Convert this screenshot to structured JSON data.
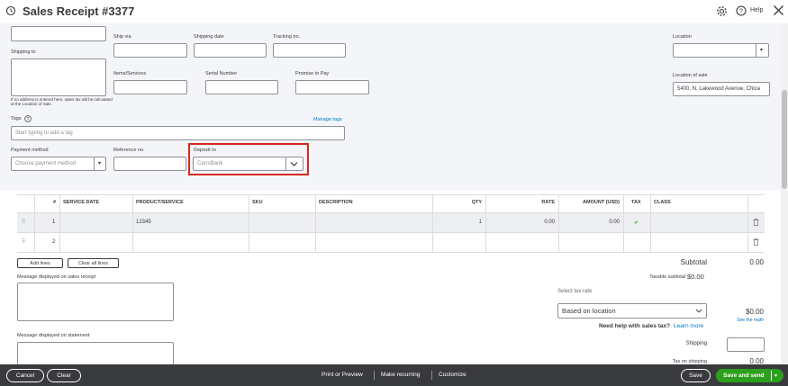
{
  "header": {
    "title": "Sales Receipt #3377",
    "help": "Help"
  },
  "form": {
    "shipping_to_label": "Shipping to",
    "address_note": "If no address is entered here, sales tax will be calculated at the Location of Sale.",
    "ship_via_label": "Ship via",
    "shipping_date_label": "Shipping date",
    "tracking_no_label": "Tracking no.",
    "items_services_label": "Items/Services",
    "serial_number_label": "Serial Number",
    "promise_to_pay_label": "Promise to Pay",
    "location_label": "Location",
    "location_of_sale_label": "Location of sale",
    "location_of_sale_value": "5400, N. Lakewood Avenue, Chica",
    "tags_label": "Tags",
    "manage_tags": "Manage tags",
    "tags_placeholder": "Start typing to add a tag",
    "payment_method_label": "Payment method",
    "payment_method_placeholder": "Choose payment method",
    "reference_no_label": "Reference no.",
    "deposit_to_label": "Deposit to",
    "deposit_to_value": "CarrsBank"
  },
  "table": {
    "headers": {
      "num": "#",
      "service_date": "SERVICE DATE",
      "product": "PRODUCT/SERVICE",
      "sku": "SKU",
      "description": "DESCRIPTION",
      "qty": "QTY",
      "rate": "RATE",
      "amount": "AMOUNT (USD)",
      "tax": "TAX",
      "class": "CLASS"
    },
    "rows": [
      {
        "num": "1",
        "product": "12345",
        "qty": "1",
        "rate": "0.00",
        "amount": "0.00",
        "tax": "✔"
      },
      {
        "num": "2",
        "product": "",
        "qty": "",
        "rate": "",
        "amount": "",
        "tax": ""
      }
    ],
    "add_lines": "Add lines",
    "clear_all_lines": "Clear all lines"
  },
  "messages": {
    "receipt_label": "Message displayed on sales receipt",
    "statement_label": "Message displayed on statement"
  },
  "totals": {
    "subtotal_label": "Subtotal",
    "subtotal_value": "0.00",
    "taxable_subtotal_label": "Taxable subtotal",
    "taxable_subtotal_value": "$0.00",
    "select_tax_rate": "Select tax rate",
    "tax_rate_value": "Based on location",
    "tax_amount": "$0.00",
    "see_the_math": "See the math",
    "need_help": "Need help with sales tax?",
    "learn_more": "Learn more",
    "shipping_label": "Shipping",
    "tax_on_shipping_label": "Tax on shipping",
    "tax_on_shipping_value": "0.00"
  },
  "footer": {
    "cancel": "Cancel",
    "clear": "Clear",
    "print_preview": "Print or Preview",
    "make_recurring": "Make recurring",
    "customize": "Customize",
    "save": "Save",
    "save_and_send": "Save and send"
  },
  "colors": {
    "accent": "#2ca01c",
    "link": "#0077c5",
    "highlight": "#d52b1e",
    "footer": "#393a3d"
  }
}
